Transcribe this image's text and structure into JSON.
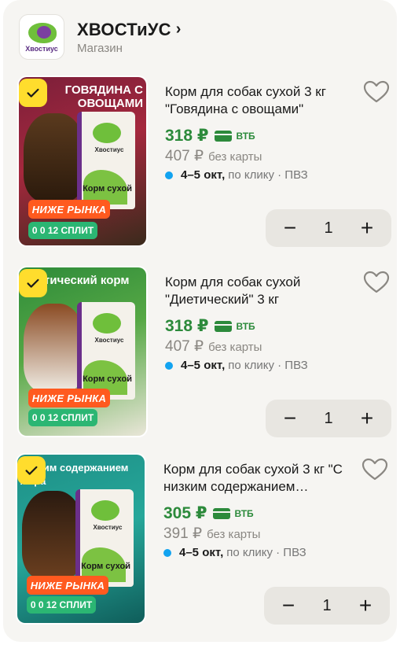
{
  "shop": {
    "name": "ХВОСТиУС",
    "subtitle": "Магазин",
    "logo_text": "Хвостиус",
    "chevron": "›"
  },
  "products": [
    {
      "title": "Корм для собак сухой 3 кг \"Говядина с овощами\"",
      "image_caption": "ГОВЯДИНА С ОВОЩАМИ",
      "pack_brand": "Хвостиус",
      "pack_title": "Корм сухой",
      "price": "318 ₽",
      "bank_label": "ВТБ",
      "old_price": "407 ₽",
      "no_card_label": "без карты",
      "delivery_date": "4–5 окт,",
      "delivery_rest": "по клику · ПВЗ",
      "badge_market": "НИЖЕ РЫНКА",
      "badge_split": "0 0 12 СПЛИТ",
      "quantity": "1",
      "selected": true
    },
    {
      "title": "Корм для собак сухой \"Диетический\" 3 кг",
      "image_caption": "Диетический корм",
      "pack_brand": "Хвостиус",
      "pack_title": "Корм сухой",
      "price": "318 ₽",
      "bank_label": "ВТБ",
      "old_price": "407 ₽",
      "no_card_label": "без карты",
      "delivery_date": "4–5 окт,",
      "delivery_rest": "по клику · ПВЗ",
      "badge_market": "НИЖЕ РЫНКА",
      "badge_split": "0 0 12 СПЛИТ",
      "quantity": "1",
      "selected": true
    },
    {
      "title": "Корм для собак сухой 3 кг \"С низким содержанием…",
      "image_caption": "низким содержанием жира",
      "pack_brand": "Хвостиус",
      "pack_title": "Корм сухой",
      "price": "305 ₽",
      "bank_label": "ВТБ",
      "old_price": "391 ₽",
      "no_card_label": "без карты",
      "delivery_date": "4–5 окт,",
      "delivery_rest": "по клику · ПВЗ",
      "badge_market": "НИЖЕ РЫНКА",
      "badge_split": "0 0 12 СПЛИТ",
      "quantity": "1",
      "selected": true
    }
  ],
  "stepper": {
    "minus": "−",
    "plus": "+"
  },
  "icons": {
    "check": "check-icon",
    "favorite": "heart-icon",
    "chevron": "chevron-right-icon"
  },
  "colors": {
    "accent_yellow": "#ffdd2d",
    "price_green": "#2c8a3b",
    "badge_orange": "#ff5a1f",
    "badge_green": "#2bb673",
    "delivery_dot": "#12a3f0"
  }
}
